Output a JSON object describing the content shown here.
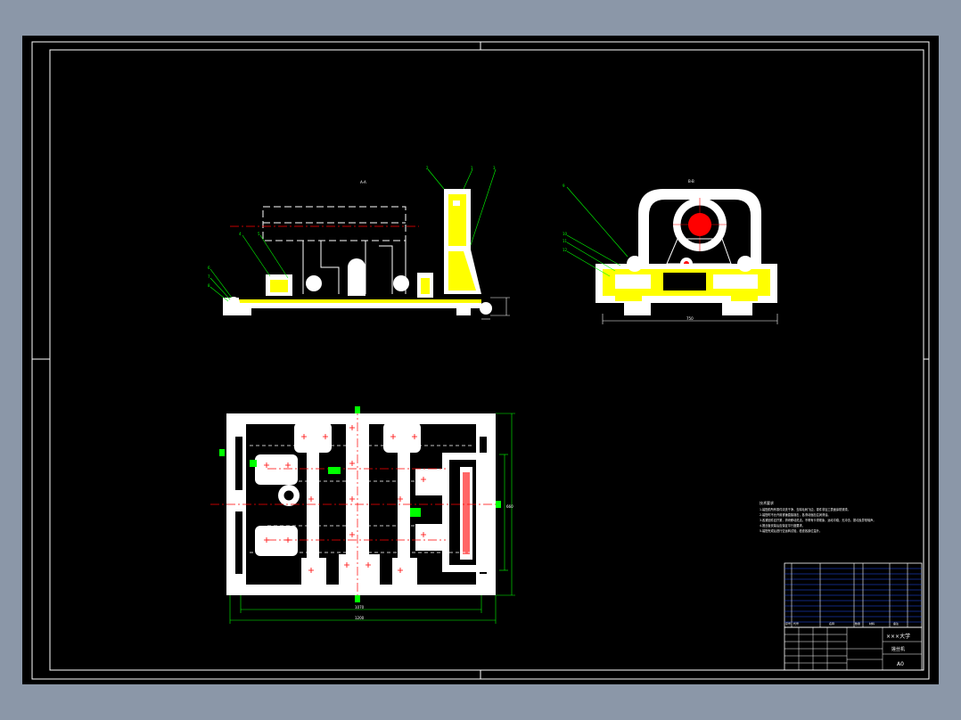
{
  "colors": {
    "window_bg": "#8b97a8",
    "sheet_bg": "#000000",
    "line": "#ffffff",
    "section": "#ffff00",
    "center": "#ff0000",
    "leader": "#00ff00",
    "table": "#0000ff",
    "notes": "#ffffff"
  },
  "title_block": {
    "school": "×××大学",
    "drawing_name": "搓丝机",
    "drawing_no": "A0"
  },
  "view_labels": {
    "front": "A-A",
    "side": "B-B"
  },
  "dimensions": {
    "side_width": "750",
    "plan_width": "1070",
    "plan_overall": "1200",
    "plan_height": "660"
  },
  "notes": {
    "heading": "技术要求",
    "lines": [
      "1.装配前所有零件清洗干净，去除毛刺飞边，零件非加工表面涂防锈漆。",
      "2.装配时不允许用铁锤直接敲击，各滑动面加注润滑油。",
      "3.各紧固件应拧紧，滑块移动灵活，不得有卡滞现象，运动平稳，无冲击、振动及异常噪声。",
      "4.搓丝板安装后应保证平行度要求。",
      "5.装配完成后进行空运转试验，检查各部位温升。"
    ]
  },
  "parts_list": {
    "header": [
      "序号",
      "代号",
      "名称",
      "数量",
      "材料",
      "备注"
    ]
  }
}
